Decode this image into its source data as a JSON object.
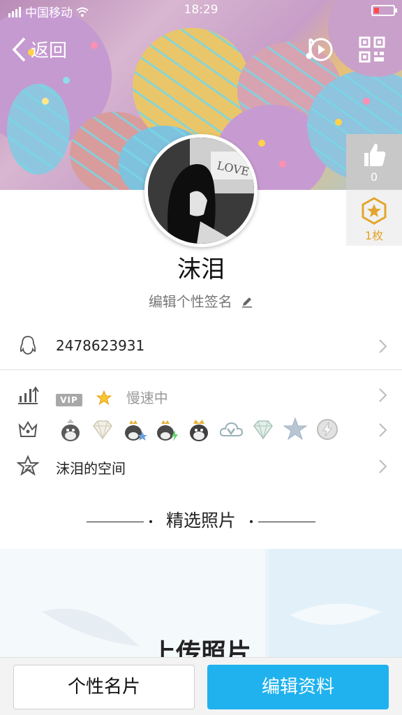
{
  "status": {
    "carrier": "中国移动",
    "time": "18:29"
  },
  "nav": {
    "back_label": "返回"
  },
  "profile": {
    "name": "沫泪",
    "signature": "编辑个性签名",
    "like_count": "0",
    "badge_count": "1枚",
    "avatar_text": "LOVE"
  },
  "rows": {
    "qq_number": "2478623931",
    "vip_label": "VIP",
    "speed_text": "慢速中",
    "space_label": "沫泪的空间"
  },
  "medals": [
    "penguin-silver-icon",
    "diamond-icon",
    "penguin-star-icon",
    "penguin-lightning-icon",
    "penguin-crown-icon",
    "cloud-v-icon",
    "diamond-green-icon",
    "star-icon",
    "lightning-gray-icon"
  ],
  "section": {
    "title": "精选照片",
    "upload_text": "上传照片"
  },
  "buttons": {
    "card": "个性名片",
    "edit": "编辑资料"
  },
  "colors": {
    "accent": "#1fb2ee",
    "badge_gold": "#e3a52c"
  }
}
